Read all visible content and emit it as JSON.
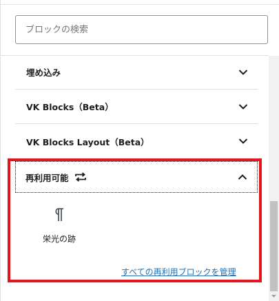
{
  "search": {
    "placeholder": "ブロックの検索"
  },
  "categories": [
    {
      "label": "埋め込み",
      "state": "collapsed"
    },
    {
      "label": "VK Blocks（Beta）",
      "state": "collapsed"
    },
    {
      "label": "VK Blocks Layout（Beta）",
      "state": "collapsed"
    }
  ],
  "reusable": {
    "label": "再利用可能",
    "state": "expanded",
    "icon": "reusable-arrows-icon",
    "blocks": [
      {
        "label": "栄光の跡",
        "icon": "pilcrow-icon"
      }
    ],
    "manage_link": "すべての再利用ブロックを管理"
  },
  "colors": {
    "highlight": "#e0151f",
    "link": "#2271b1"
  }
}
